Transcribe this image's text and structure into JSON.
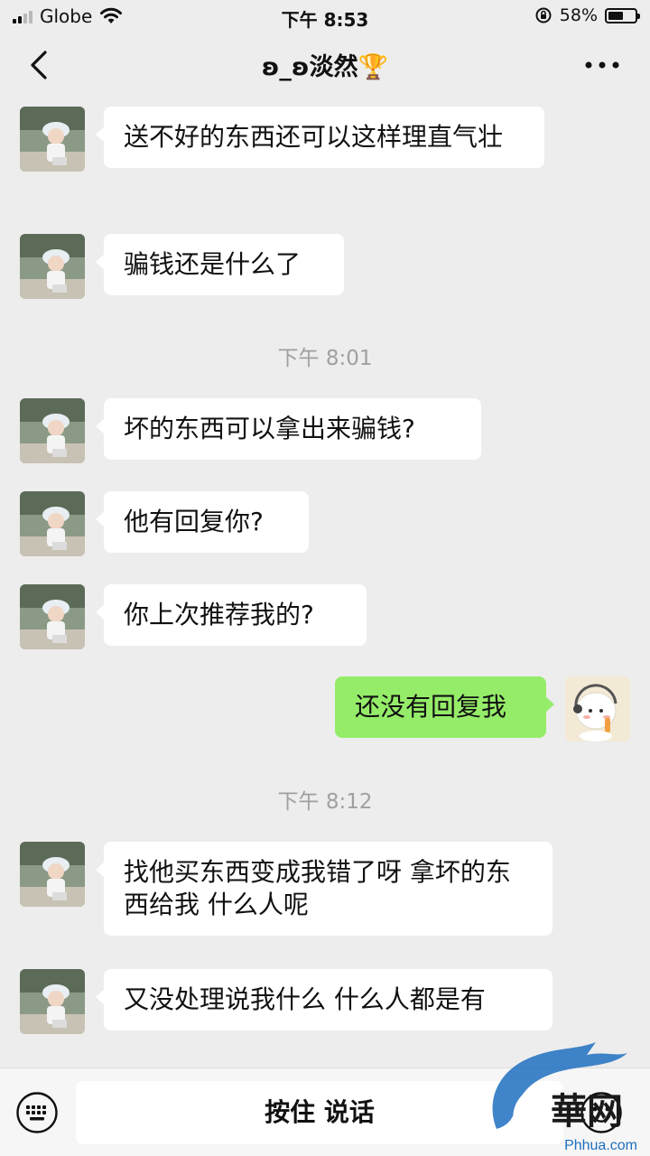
{
  "status_bar": {
    "carrier": "Globe",
    "time": "下午 8:53",
    "battery": "58%",
    "battery_level": 0.58
  },
  "nav": {
    "title": "ʚ_ʚ淡然🏆",
    "back_icon": "chevron-left-icon",
    "more_icon": "more-dots-icon"
  },
  "messages": [
    {
      "side": "in",
      "text": "送不好的东西还可以这样理直气壮"
    },
    {
      "side": "in",
      "text": "骗钱还是什么了"
    },
    {
      "type": "time",
      "text": "下午 8:01"
    },
    {
      "side": "in",
      "text": "坏的东西可以拿出来骗钱?"
    },
    {
      "side": "in",
      "text": "他有回复你?"
    },
    {
      "side": "in",
      "text": "你上次推荐我的?"
    },
    {
      "side": "out",
      "text": "还没有回复我"
    },
    {
      "type": "time",
      "text": "下午 8:12"
    },
    {
      "side": "in",
      "text": "找他买东西变成我错了呀 拿坏的东西给我 什么人呢"
    },
    {
      "side": "in",
      "text": "又没处理说我什么 什么人都是有"
    }
  ],
  "input_bar": {
    "voice_label": "按住 说话",
    "keyboard_icon": "keyboard-icon",
    "emoji_icon": "emoji-icon"
  },
  "watermark": {
    "text": "Phhua.com"
  },
  "colors": {
    "background": "#ededed",
    "outgoing_bubble": "#95ec69",
    "incoming_bubble": "#ffffff",
    "timestamp": "#a0a0a0"
  }
}
